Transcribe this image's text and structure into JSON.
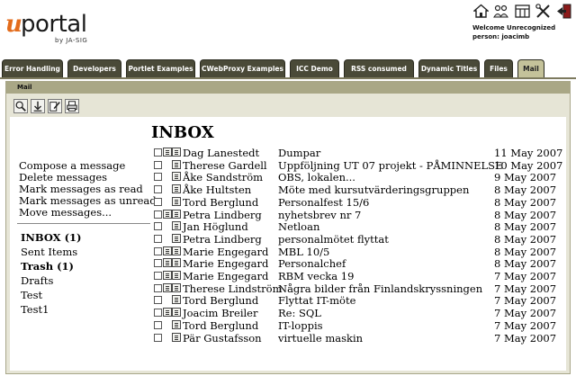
{
  "logo": {
    "u": "u",
    "portal": "portal",
    "byline": "by JA-SIG"
  },
  "header": {
    "icons": [
      "home-icon",
      "group-icon",
      "layout-icon",
      "tools-icon",
      "logout-icon"
    ],
    "welcome": "Welcome Unrecognized person: joacimb"
  },
  "tabs": [
    {
      "label": "Error Handling",
      "active": false
    },
    {
      "label": "Developers",
      "active": false
    },
    {
      "label": "Portlet Examples",
      "active": false
    },
    {
      "label": "CWebProxy Examples",
      "active": false
    },
    {
      "label": "ICC Demo",
      "active": false
    },
    {
      "label": "RSS consumed",
      "active": false
    },
    {
      "label": "Dynamic Titles",
      "active": false
    },
    {
      "label": "Files",
      "active": false
    },
    {
      "label": "Mail",
      "active": true
    }
  ],
  "channel": {
    "title": "Mail",
    "toolbar": [
      "zoom-icon",
      "download-icon",
      "edit-icon",
      "print-icon"
    ]
  },
  "inbox": {
    "title": "INBOX",
    "commands": [
      "Compose a message",
      "Delete messages",
      "Mark messages as read",
      "Mark messages as unread",
      "Move messages..."
    ],
    "folders": [
      {
        "label": "INBOX (1)",
        "bold": true
      },
      {
        "label": "Sent Items",
        "bold": false
      },
      {
        "label": "Trash (1)",
        "bold": true
      },
      {
        "label": "Drafts",
        "bold": false
      },
      {
        "label": "Test",
        "bold": false
      },
      {
        "label": "Test1",
        "bold": false
      }
    ],
    "messages": [
      {
        "flags": 2,
        "from": "Dag Lanestedt",
        "subject": "Dumpar",
        "date": "11 May 2007"
      },
      {
        "flags": 1,
        "from": "Therese Gardell",
        "subject": "Uppföljning UT 07 projekt - PÅMINNELSE",
        "date": "10 May 2007"
      },
      {
        "flags": 1,
        "from": "Åke Sandström",
        "subject": "OBS, lokalen...",
        "date": "9 May 2007"
      },
      {
        "flags": 1,
        "from": "Åke Hultsten",
        "subject": "Möte med kursutvärderingsgruppen",
        "date": "8 May 2007"
      },
      {
        "flags": 1,
        "from": "Tord Berglund",
        "subject": "Personalfest 15/6",
        "date": "8 May 2007"
      },
      {
        "flags": 2,
        "from": "Petra Lindberg",
        "subject": "nyhetsbrev nr 7",
        "date": "8 May 2007"
      },
      {
        "flags": 1,
        "from": "Jan Höglund",
        "subject": "Netloan",
        "date": "8 May 2007"
      },
      {
        "flags": 1,
        "from": "Petra Lindberg",
        "subject": "personalmötet flyttat",
        "date": "8 May 2007"
      },
      {
        "flags": 2,
        "from": "Marie Engegard",
        "subject": "MBL 10/5",
        "date": "8 May 2007"
      },
      {
        "flags": 2,
        "from": "Marie Engegard",
        "subject": "Personalchef",
        "date": "8 May 2007"
      },
      {
        "flags": 2,
        "from": "Marie Engegard",
        "subject": "RBM vecka 19",
        "date": "7 May 2007"
      },
      {
        "flags": 2,
        "from": "Therese Lindström",
        "subject": "Några bilder från Finlandskryssningen",
        "date": "7 May 2007"
      },
      {
        "flags": 1,
        "from": "Tord Berglund",
        "subject": "Flyttat IT-möte",
        "date": "7 May 2007"
      },
      {
        "flags": 2,
        "from": "Joacim Breiler",
        "subject": "Re: SQL",
        "date": "7 May 2007"
      },
      {
        "flags": 1,
        "from": "Tord Berglund",
        "subject": "IT-loppis",
        "date": "7 May 2007"
      },
      {
        "flags": 1,
        "from": "Pär Gustafsson",
        "subject": "virtuelle maskin",
        "date": "7 May 2007"
      }
    ]
  }
}
